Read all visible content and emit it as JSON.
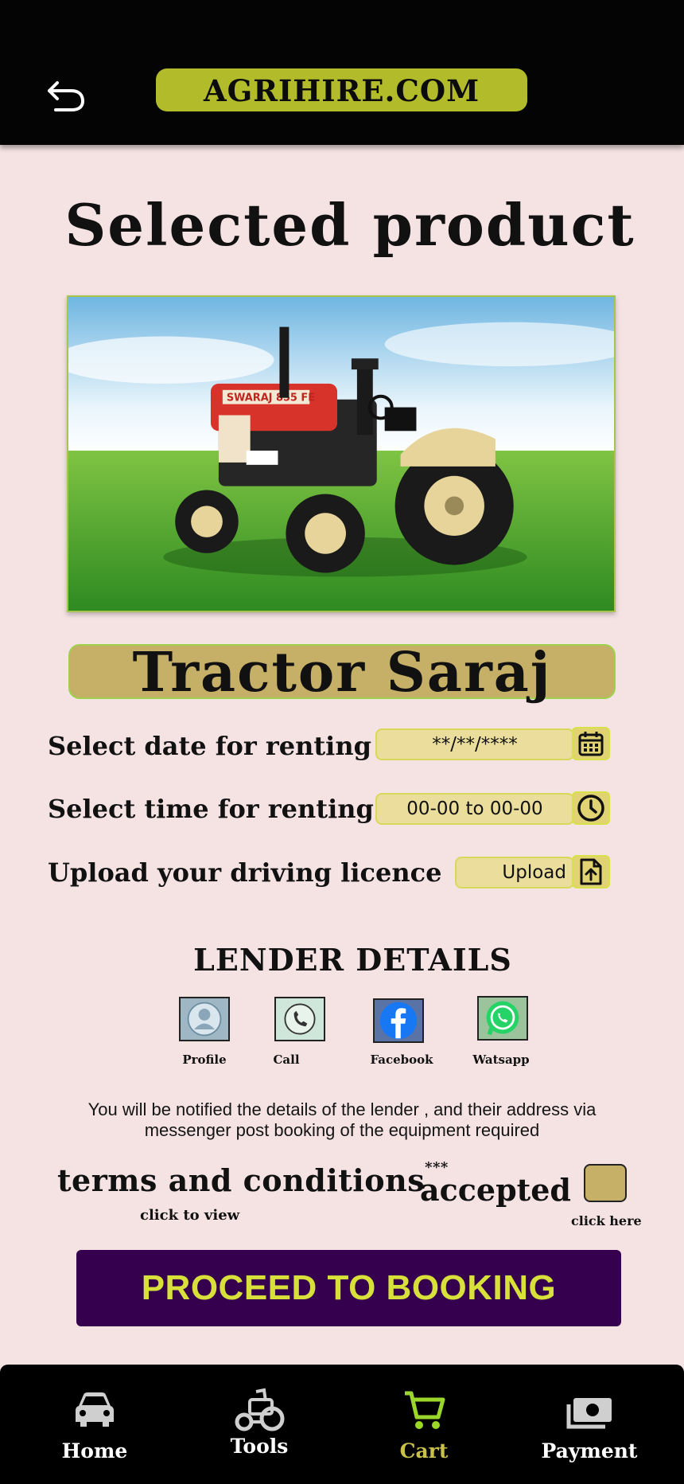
{
  "header": {
    "brand": "AGRIHIRE.COM",
    "back_icon": "back-arrow-icon"
  },
  "page_title": "Selected product",
  "product": {
    "name": "Tractor Saraj",
    "image_badge": "SWARAJ 855 FE"
  },
  "rental": {
    "date_label": "Select date for renting",
    "date_value": "**/**/****",
    "date_icon": "calendar-icon",
    "time_label": "Select time for renting",
    "time_value": "00-00 to 00-00",
    "time_icon": "clock-icon",
    "licence_label": "Upload your driving licence",
    "upload_label": "Upload",
    "upload_icon": "file-upload-icon"
  },
  "lender": {
    "title": "LENDER DETAILS",
    "contacts": [
      {
        "label": "Profile",
        "icon": "profile-icon"
      },
      {
        "label": "Call",
        "icon": "phone-icon"
      },
      {
        "label": "Facebook",
        "icon": "facebook-icon"
      },
      {
        "label": "Watsapp",
        "icon": "whatsapp-icon"
      }
    ],
    "notice": "You will be notified the details of the lender , and their address via messenger post booking of the equipment required"
  },
  "terms": {
    "label": "terms and conditions",
    "asterisks": "***",
    "click_to_view": "click to view",
    "accepted": "accepted",
    "click_here": "click here"
  },
  "proceed_label": "PROCEED TO BOOKING",
  "nav": {
    "items": [
      {
        "label": "Home",
        "icon": "car-icon",
        "active": false
      },
      {
        "label": "Tools",
        "icon": "tractor-icon",
        "active": false
      },
      {
        "label": "Cart",
        "icon": "cart-icon",
        "active": true
      },
      {
        "label": "Payment",
        "icon": "money-icon",
        "active": false
      }
    ]
  },
  "colors": {
    "background": "#f5e3e4",
    "brand_pill": "#b2bb2a",
    "product_pill": "#c6b068",
    "input_pill": "#ebde9c",
    "proceed_bg": "#35004e",
    "proceed_text": "#d8e03a",
    "nav_active": "#9bd62b",
    "nav_active_label": "#c9c04a"
  }
}
